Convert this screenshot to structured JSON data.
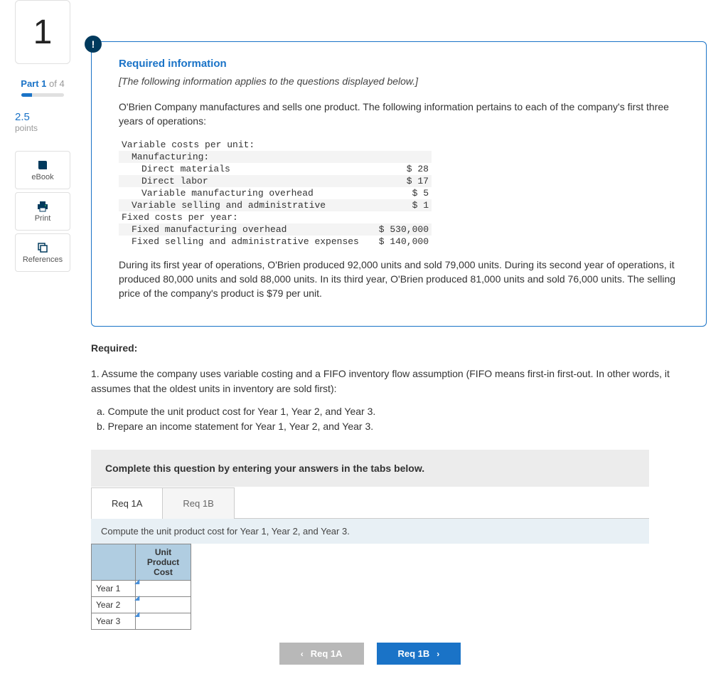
{
  "sidebar": {
    "question_num": "1",
    "part_bold": "Part 1",
    "part_of": " of 4",
    "points_value": "2.5",
    "points_label": "points",
    "ebook": "eBook",
    "print": "Print",
    "references": "References"
  },
  "alert": "!",
  "info": {
    "title": "Required information",
    "note": "[The following information applies to the questions displayed below.]",
    "para1": "O'Brien Company manufactures and sells one product. The following information pertains to each of the company's first three years of operations:",
    "para2": "During its first year of operations, O'Brien produced 92,000 units and sold 79,000 units. During its second year of operations, it produced 80,000 units and sold 88,000 units. In its third year, O'Brien produced 81,000 units and sold 76,000 units. The selling price of the company's product is $79 per unit."
  },
  "costs": {
    "h_variable": "Variable costs per unit:",
    "h_manu": "Manufacturing:",
    "dm_label": "Direct materials",
    "dm_val": "$ 28",
    "dl_label": "Direct labor",
    "dl_val": "$ 17",
    "vmo_label": "Variable manufacturing overhead",
    "vmo_val": "$ 5",
    "vsa_label": "Variable selling and administrative",
    "vsa_val": "$ 1",
    "h_fixed": "Fixed costs per year:",
    "fmo_label": "Fixed manufacturing overhead",
    "fmo_val": "$ 530,000",
    "fsa_label": "Fixed selling and administrative expenses",
    "fsa_val": "$ 140,000"
  },
  "required": {
    "label": "Required:",
    "q1": "1. Assume the company uses variable costing and a FIFO inventory flow assumption (FIFO means first-in first-out. In other words, it assumes that the oldest units in inventory are sold first):",
    "a": "a. Compute the unit product cost for Year 1, Year 2, and Year 3.",
    "b": "b. Prepare an income statement for Year 1, Year 2, and Year 3."
  },
  "answer": {
    "instruction": "Complete this question by entering your answers in the tabs below.",
    "tab1": "Req 1A",
    "tab2": "Req 1B",
    "tab_instruction": "Compute the unit product cost for Year 1, Year 2, and Year 3.",
    "col_header": "Unit Product Cost",
    "row1": "Year 1",
    "row2": "Year 2",
    "row3": "Year 3",
    "prev_btn": "Req 1A",
    "next_btn": "Req 1B"
  }
}
